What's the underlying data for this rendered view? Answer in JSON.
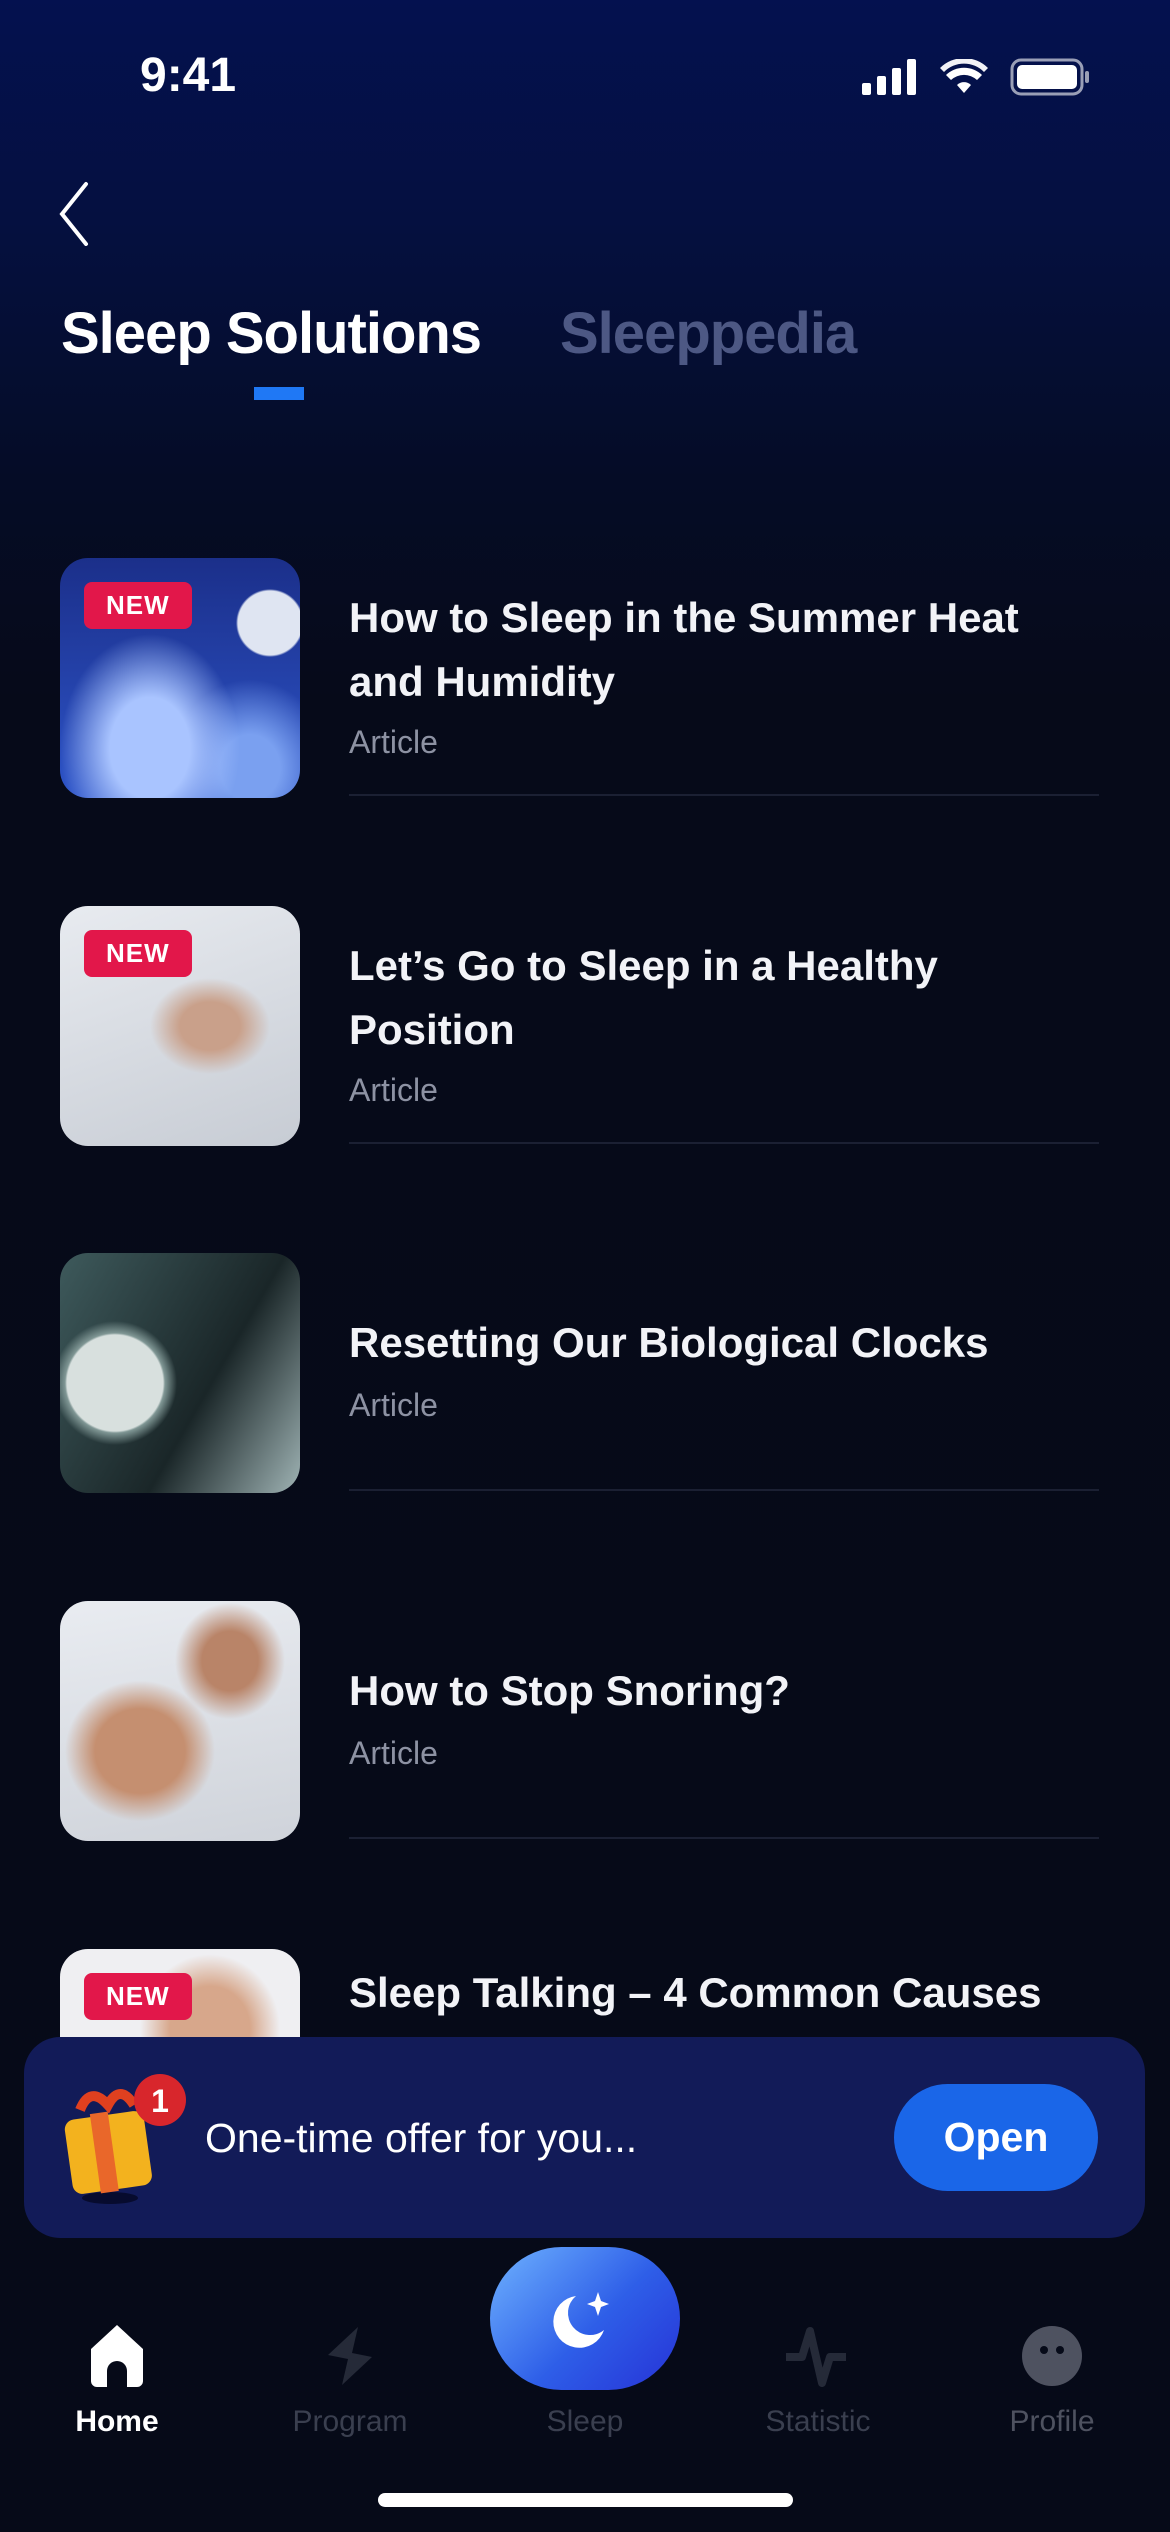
{
  "status_bar": {
    "time": "9:41"
  },
  "tabs": [
    {
      "label": "Sleep Solutions",
      "active": true
    },
    {
      "label": "Sleeppedia",
      "active": false
    }
  ],
  "articles": [
    {
      "title": "How to Sleep in the Summer Heat and Humidity",
      "type": "Article",
      "badge": "NEW"
    },
    {
      "title": "Let’s Go to Sleep in a Healthy Position",
      "type": "Article",
      "badge": "NEW"
    },
    {
      "title": "Resetting Our Biological Clocks",
      "type": "Article"
    },
    {
      "title": "How to Stop Snoring?",
      "type": "Article"
    },
    {
      "title": "Sleep Talking – 4 Common Causes",
      "badge": "NEW"
    }
  ],
  "offer": {
    "text": "One-time offer for you...",
    "badge_count": "1",
    "button": "Open"
  },
  "nav": [
    {
      "label": "Home",
      "icon": "home-icon",
      "active": true
    },
    {
      "label": "Program",
      "icon": "program-icon"
    },
    {
      "label": "Sleep",
      "icon": "moon-icon"
    },
    {
      "label": "Statistic",
      "icon": "pulse-icon"
    },
    {
      "label": "Profile",
      "icon": "profile-icon"
    }
  ],
  "colors": {
    "accent": "#1a66e8",
    "badge": "#e2174a",
    "banner": "#121b58"
  }
}
